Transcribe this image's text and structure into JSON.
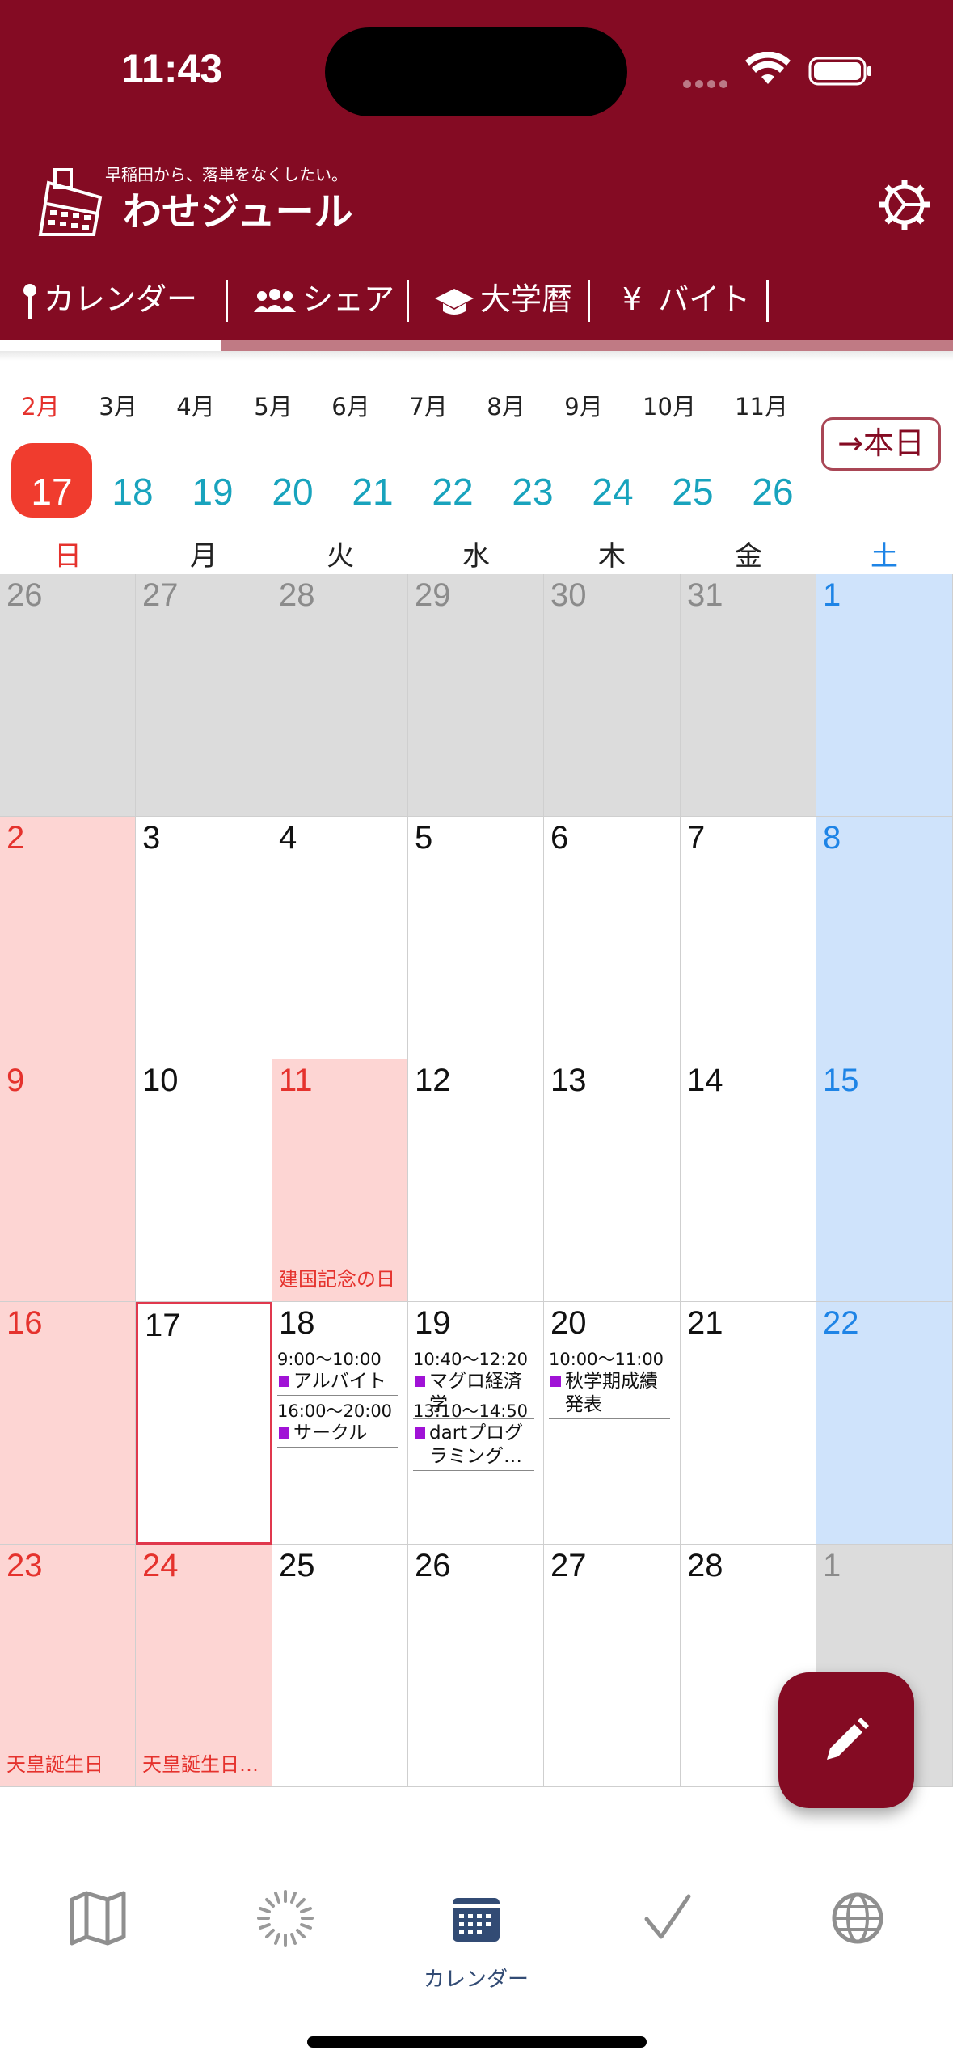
{
  "status_bar": {
    "time": "11:43"
  },
  "header": {
    "tagline": "早稲田から、落単をなくしたい。",
    "title": "わせジュール",
    "colors": {
      "brand": "#840b23"
    }
  },
  "tabs": [
    {
      "label": "カレンダー",
      "icon": "pin-icon"
    },
    {
      "label": "シェア",
      "icon": "people-icon"
    },
    {
      "label": "大学暦",
      "icon": "graduation-cap-icon"
    },
    {
      "label": "バイト",
      "icon": "yen-icon",
      "prefix": "¥"
    }
  ],
  "month_strip": [
    "2月",
    "3月",
    "4月",
    "5月",
    "6月",
    "7月",
    "8月",
    "9月",
    "10月",
    "11月"
  ],
  "active_month": "2月",
  "today_button": "→本日",
  "date_strip": [
    "17",
    "18",
    "19",
    "20",
    "21",
    "22",
    "23",
    "24",
    "25",
    "26"
  ],
  "active_date": "17",
  "weekdays": [
    "日",
    "月",
    "火",
    "水",
    "木",
    "金",
    "土"
  ],
  "calendar": {
    "weeks": [
      [
        {
          "d": "26",
          "k": "out"
        },
        {
          "d": "27",
          "k": "out"
        },
        {
          "d": "28",
          "k": "out"
        },
        {
          "d": "29",
          "k": "out"
        },
        {
          "d": "30",
          "k": "out"
        },
        {
          "d": "31",
          "k": "out"
        },
        {
          "d": "1",
          "k": "sat"
        }
      ],
      [
        {
          "d": "2",
          "k": "sun"
        },
        {
          "d": "3"
        },
        {
          "d": "4"
        },
        {
          "d": "5"
        },
        {
          "d": "6"
        },
        {
          "d": "7"
        },
        {
          "d": "8",
          "k": "sat"
        }
      ],
      [
        {
          "d": "9",
          "k": "sun"
        },
        {
          "d": "10"
        },
        {
          "d": "11",
          "k": "hol",
          "holiday": "建国記念の日"
        },
        {
          "d": "12"
        },
        {
          "d": "13"
        },
        {
          "d": "14"
        },
        {
          "d": "15",
          "k": "sat"
        }
      ],
      [
        {
          "d": "16",
          "k": "sun"
        },
        {
          "d": "17",
          "k": "today"
        },
        {
          "d": "18",
          "events": [
            {
              "time": "9:00〜10:00",
              "title": "アルバイト"
            },
            {
              "time": "16:00〜20:00",
              "title": "サークル"
            }
          ]
        },
        {
          "d": "19",
          "events": [
            {
              "time": "10:40〜12:20",
              "title": "マグロ経済学"
            },
            {
              "time": "13:10〜14:50",
              "title": "dartプログラミング…"
            }
          ]
        },
        {
          "d": "20",
          "events": [
            {
              "time": "10:00〜11:00",
              "title": "秋学期成績発表"
            }
          ]
        },
        {
          "d": "21"
        },
        {
          "d": "22",
          "k": "sat"
        }
      ],
      [
        {
          "d": "23",
          "k": "hol",
          "holiday": "天皇誕生日"
        },
        {
          "d": "24",
          "k": "hol",
          "holiday": "天皇誕生日…"
        },
        {
          "d": "25"
        },
        {
          "d": "26"
        },
        {
          "d": "27"
        },
        {
          "d": "28"
        },
        {
          "d": "1",
          "k": "out"
        }
      ]
    ]
  },
  "fab": {
    "icon": "pencil-icon"
  },
  "bottom_nav": [
    {
      "icon": "map-icon",
      "label": ""
    },
    {
      "icon": "loading-icon",
      "label": ""
    },
    {
      "icon": "calendar-icon",
      "label": "カレンダー"
    },
    {
      "icon": "check-icon",
      "label": ""
    },
    {
      "icon": "globe-icon",
      "label": ""
    }
  ]
}
